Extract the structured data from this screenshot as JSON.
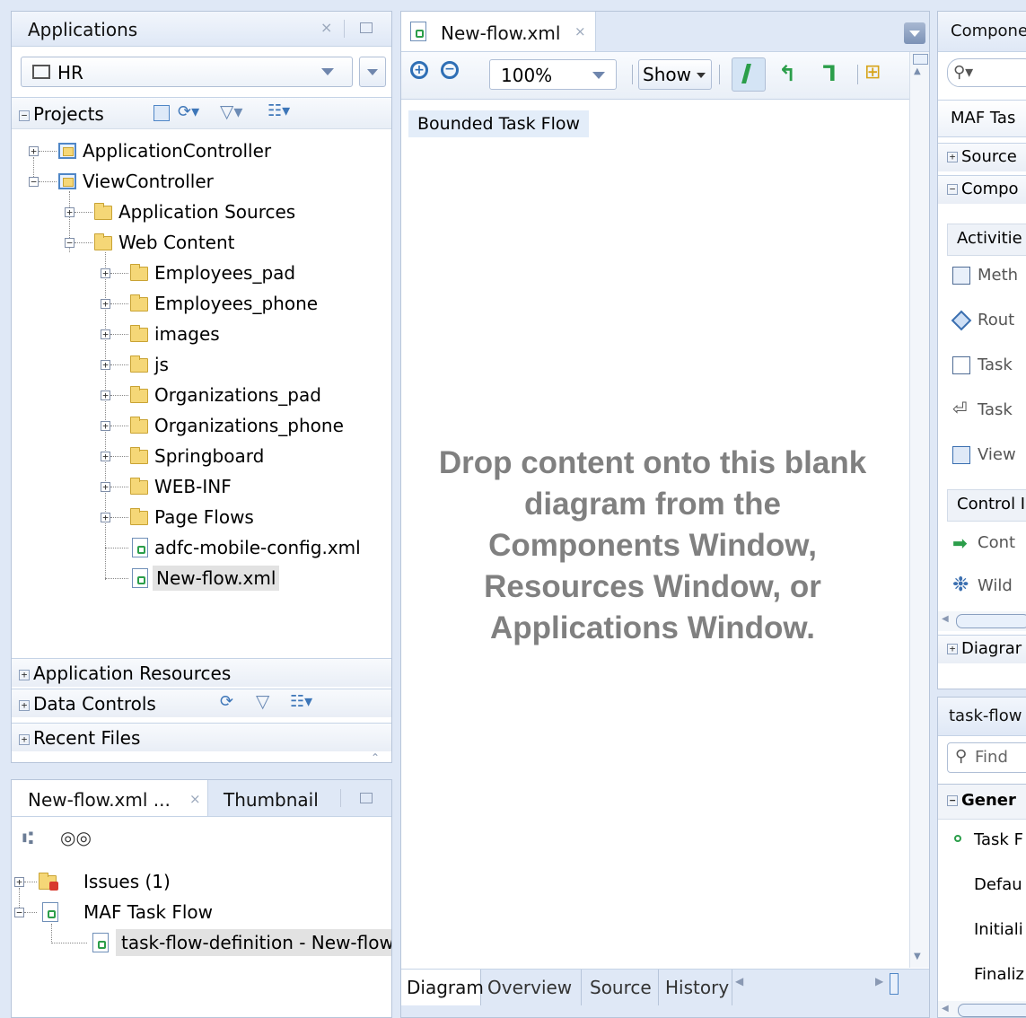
{
  "applications_panel": {
    "title": "Applications",
    "app_selector": "HR",
    "projects_label": "Projects",
    "tree": [
      {
        "label": "ApplicationController"
      },
      {
        "label": "ViewController"
      },
      {
        "label": "Application Sources"
      },
      {
        "label": "Web Content"
      },
      {
        "label": "Employees_pad"
      },
      {
        "label": "Employees_phone"
      },
      {
        "label": "images"
      },
      {
        "label": "js"
      },
      {
        "label": "Organizations_pad"
      },
      {
        "label": "Organizations_phone"
      },
      {
        "label": "Springboard"
      },
      {
        "label": "WEB-INF"
      },
      {
        "label": "Page Flows"
      },
      {
        "label": "adfc-mobile-config.xml"
      },
      {
        "label": "New-flow.xml"
      }
    ],
    "sections": {
      "app_resources": "Application Resources",
      "data_controls": "Data Controls",
      "recent_files": "Recent Files"
    }
  },
  "structure_panel": {
    "tab1": "New-flow.xml ...",
    "tab2": "Thumbnail",
    "tree": [
      {
        "label": "Issues (1)"
      },
      {
        "label": "MAF Task Flow"
      },
      {
        "label": "task-flow-definition - New-flow"
      }
    ]
  },
  "editor": {
    "tab": "New-flow.xml",
    "zoom": "100%",
    "show": "Show",
    "flow_label": "Bounded Task Flow",
    "message_lines": [
      "Drop content onto this blank",
      "diagram from the",
      "Components Window,",
      "Resources Window, or",
      "Applications Window."
    ],
    "bottom_tabs": [
      "Diagram",
      "Overview",
      "Source",
      "History"
    ]
  },
  "components_panel": {
    "title": "Compone",
    "dropdown": "MAF Tas",
    "source_section": "Source",
    "compo_section": "Compo",
    "activities_header": "Activitie",
    "items": [
      "Meth",
      "Rout",
      "Task",
      "Task",
      "View"
    ],
    "control_header": "Control I",
    "control_items": [
      "Cont",
      "Wild"
    ],
    "diagram_section": "Diagrar"
  },
  "properties_panel": {
    "title": "task-flow",
    "find_placeholder": "Find",
    "general_header": "Gener",
    "rows": [
      "Task F",
      "Defau",
      "Initiali",
      "Finaliz"
    ]
  },
  "colors": {
    "accent_blue": "#4f86c6",
    "message_gray": "#808080",
    "panel_bg": "#dfe8f6"
  }
}
